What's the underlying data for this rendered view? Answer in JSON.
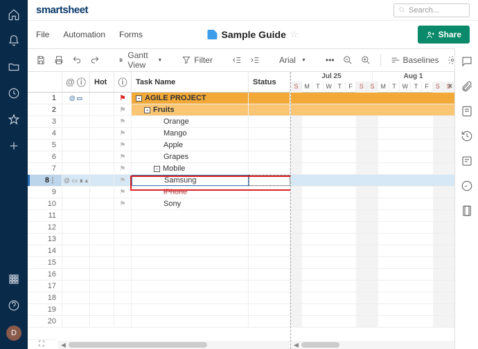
{
  "logo": "smartsheet",
  "search": {
    "placeholder": "Search..."
  },
  "menu": {
    "file": "File",
    "automation": "Automation",
    "forms": "Forms"
  },
  "doc": {
    "title": "Sample Guide"
  },
  "share_label": "Share",
  "toolbar": {
    "view_label": "Gantt View",
    "filter_label": "Filter",
    "font_label": "Arial",
    "baselines_label": "Baselines"
  },
  "columns": {
    "hot": "Hot",
    "task": "Task Name",
    "status": "Status"
  },
  "gantt": {
    "month1": "Jul 25",
    "month2": "Aug 1",
    "days": [
      "S",
      "M",
      "T",
      "W",
      "T",
      "F",
      "S",
      "S",
      "M",
      "T",
      "W",
      "T",
      "F",
      "S",
      "S"
    ]
  },
  "rows": [
    {
      "n": "1",
      "type": "project",
      "task": "AGILE PROJECT",
      "flag": "red",
      "attach": true,
      "comment": true,
      "collapse": "-"
    },
    {
      "n": "2",
      "type": "fruits",
      "task": "Fruits",
      "flag": "gray",
      "collapse": "-"
    },
    {
      "n": "3",
      "type": "item",
      "task": "Orange",
      "flag": "gray"
    },
    {
      "n": "4",
      "type": "item",
      "task": "Mango",
      "flag": "gray"
    },
    {
      "n": "5",
      "type": "item",
      "task": "Apple",
      "flag": "gray"
    },
    {
      "n": "6",
      "type": "item",
      "task": "Grapes",
      "flag": "gray"
    },
    {
      "n": "7",
      "type": "sub",
      "task": "Mobile",
      "flag": "gray",
      "collapse": "-"
    },
    {
      "n": "8",
      "type": "selected",
      "task": "Samsung",
      "flag": "gray",
      "icons": true
    },
    {
      "n": "9",
      "type": "item",
      "task": "iPhone",
      "flag": "gray",
      "strike": true
    },
    {
      "n": "10",
      "type": "item",
      "task": "Sony",
      "flag": "gray"
    },
    {
      "n": "11"
    },
    {
      "n": "12"
    },
    {
      "n": "13"
    },
    {
      "n": "14"
    },
    {
      "n": "15"
    },
    {
      "n": "16"
    },
    {
      "n": "17"
    },
    {
      "n": "18"
    },
    {
      "n": "19"
    },
    {
      "n": "20"
    }
  ],
  "avatar_initial": "D"
}
